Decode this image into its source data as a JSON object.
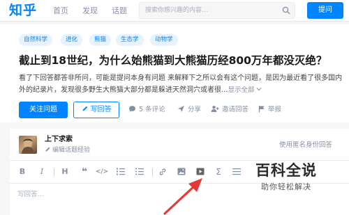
{
  "header": {
    "logo": "知乎",
    "nav": [
      "首页",
      "发现",
      "话题"
    ],
    "search_placeholder": "搜索你感兴趣的内容...",
    "ask_button": "提问"
  },
  "question": {
    "tags": [
      "自然科学",
      "进化",
      "熊猫",
      "生态学",
      "动物学"
    ],
    "title": "截止到18世纪，为什么始熊猫到大熊猫历经800万年都没灭绝？",
    "description": "看了下回答都答非所问，可能是提问本身有问题 来解释下之所以会有这个问题，是因为最近看了很多国内外的纪录片，发现很多野生大熊猫大部分都是躲进天然洞穴或者很...",
    "show_all": "显示全部",
    "follow_button": "关注问题",
    "write_button": "写回答",
    "actions": {
      "comments": "5 条评论",
      "share": "分享",
      "invite": "邀请回答",
      "report": "举报"
    }
  },
  "editor": {
    "username": "上下求索",
    "edit_experience": "编辑话题经验",
    "anonymous": "使用匿名身份回答",
    "toolbar": [
      "B",
      "I",
      "H",
      "❝",
      "</>",
      "ordered-list",
      "unordered-list",
      "link",
      "image",
      "video",
      "Σ",
      "divider"
    ],
    "placeholder": "写回答..."
  },
  "watermark": {
    "title": "百科全说",
    "subtitle": "助你轻松解决"
  },
  "colors": {
    "brand": "#0084ff",
    "tag_bg": "#e5f2ff",
    "muted": "#8590a6",
    "arrow": "#e53935"
  }
}
